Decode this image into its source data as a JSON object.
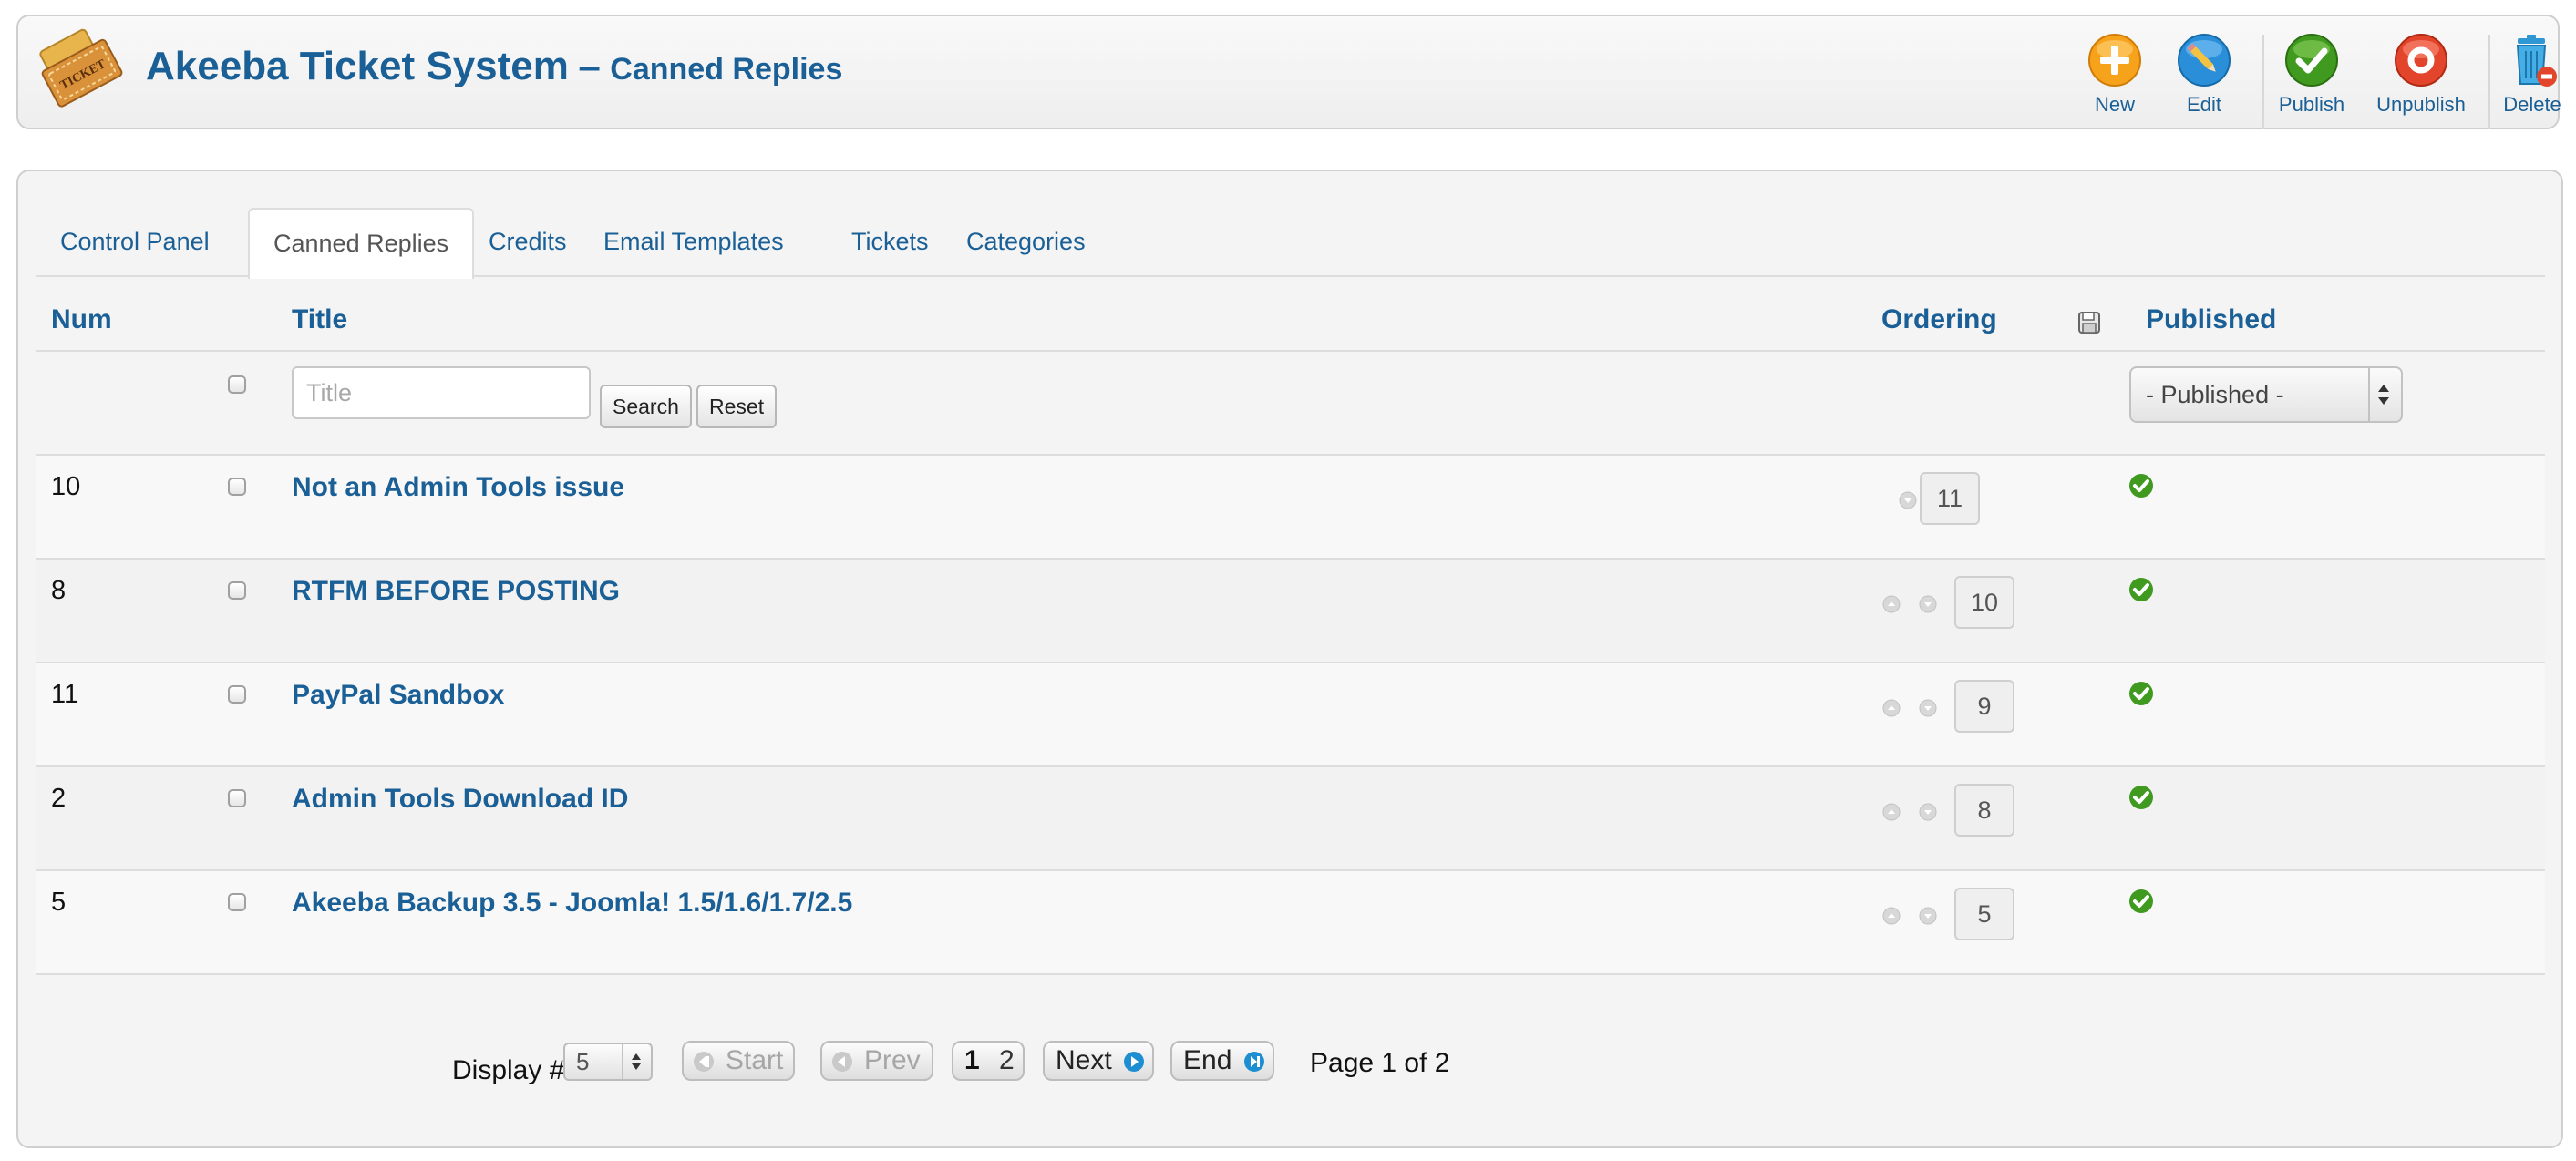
{
  "header": {
    "title": "Akeeba Ticket System",
    "dash": "–",
    "subtitle": "Canned Replies",
    "logo_text": "TICKET"
  },
  "toolbar": {
    "new": "New",
    "edit": "Edit",
    "publish": "Publish",
    "unpublish": "Unpublish",
    "delete": "Delete"
  },
  "tabs": [
    {
      "label": "Control Panel"
    },
    {
      "label": "Canned Replies",
      "active": true
    },
    {
      "label": "Credits"
    },
    {
      "label": "Email Templates"
    },
    {
      "label": "Tickets"
    },
    {
      "label": "Categories"
    }
  ],
  "columns": {
    "num": "Num",
    "title": "Title",
    "ordering": "Ordering",
    "published": "Published"
  },
  "filters": {
    "title_placeholder": "Title",
    "search_label": "Search",
    "reset_label": "Reset",
    "published_selected": "- Published -"
  },
  "rows": [
    {
      "num": "10",
      "title": "Not an Admin Tools issue",
      "ordering": "11",
      "published": true
    },
    {
      "num": "8",
      "title": "RTFM BEFORE POSTING",
      "ordering": "10",
      "published": true
    },
    {
      "num": "11",
      "title": "PayPal Sandbox",
      "ordering": "9",
      "published": true
    },
    {
      "num": "2",
      "title": "Admin Tools Download ID",
      "ordering": "8",
      "published": true
    },
    {
      "num": "5",
      "title": "Akeeba Backup 3.5 - Joomla! 1.5/1.6/1.7/2.5",
      "ordering": "5",
      "published": true
    }
  ],
  "pagination": {
    "display_label": "Display #",
    "display_value": "5",
    "start": "Start",
    "prev": "Prev",
    "page1": "1",
    "page2": "2",
    "next": "Next",
    "end": "End",
    "page_info": "Page 1 of 2"
  },
  "colors": {
    "brand_blue": "#1a5f96",
    "new_orange": "#f7a21b",
    "edit_blue": "#2a8fd8",
    "publish_green": "#3f9a1f",
    "unpublish_red": "#e2452b",
    "delete_blue": "#2f97d4"
  }
}
